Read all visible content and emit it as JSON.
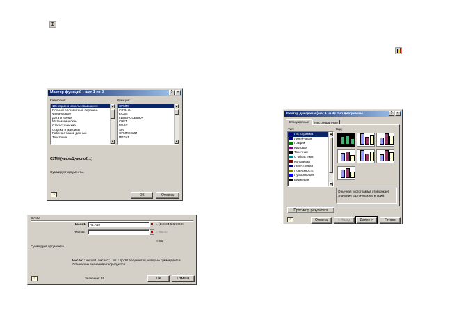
{
  "toolbar_icons": {
    "autosum": "sigma-icon",
    "chart_wizard": "chart-wizard-icon"
  },
  "function_wizard": {
    "title": "Мастер функций - шаг 1 из 2",
    "category_label": "Категория:",
    "function_label": "Функция:",
    "categories": [
      "10 недавно использовавшихся",
      "Полный алфавитный перечень",
      "Финансовые",
      "Дата и время",
      "Математические",
      "Статистические",
      "Ссылки и массивы",
      "Работа с базой данных",
      "Текстовые"
    ],
    "functions": [
      "СУММ",
      "СРЗНАЧ",
      "ЕСЛИ",
      "ГИПЕРССЫЛКА",
      "СЧЕТ",
      "МАКС",
      "SIN",
      "СУММЕСЛИ",
      "ППЛАТ"
    ],
    "signature": "СУММ(число1;число2;...)",
    "description": "Суммирует аргументы.",
    "ok": "ОК",
    "cancel": "Отмена"
  },
  "args_dialog": {
    "function_name": "СУММ",
    "number1_label": "Число1",
    "number1_value": "A1:A10",
    "number1_result": "= {1:2:3:4:5:6:7:8:9:",
    "number2_label": "Число2",
    "number2_result": "= число",
    "total": "= 55",
    "description": "Суммирует аргументы.",
    "arg_help_bold": "Число1:",
    "arg_help": "число1; число2;... от 1 до 30 аргументов, которые суммируются. Логические значения игнорируются.",
    "value_line": "Значение: 55",
    "ok": "ОК",
    "cancel": "Отмена"
  },
  "chart_wizard": {
    "title": "Мастер диаграмм (шаг 1 из 4): тип диаграммы",
    "tab_standard": "Стандартные",
    "tab_custom": "Нестандартные",
    "type_label": "Тип:",
    "view_label": "Вид:",
    "types": [
      "Гистограмма",
      "Линейчатая",
      "График",
      "Круговая",
      "Точечная",
      "С областями",
      "Кольцевая",
      "Лепестковая",
      "Поверхность",
      "Пузырьковая",
      "Биржевая"
    ],
    "type_icons": [
      "column-chart-icon",
      "bar-chart-icon",
      "line-chart-icon",
      "pie-chart-icon",
      "scatter-chart-icon",
      "area-chart-icon",
      "doughnut-chart-icon",
      "radar-chart-icon",
      "surface-chart-icon",
      "bubble-chart-icon",
      "stock-chart-icon"
    ],
    "type_icon_colors": [
      "#000080",
      "#000080",
      "#008000",
      "#800080",
      "#000000",
      "#008080",
      "#800000",
      "#000080",
      "#808000",
      "#0000ff",
      "#000000"
    ],
    "view_description": "Обычная гистограмма отображает значения различных категорий.",
    "preview_button": "Просмотр результата",
    "cancel": "Отмена",
    "back": "< Назад",
    "next": "Далее >",
    "finish": "Готово",
    "colors": {
      "series1": "#9999ff",
      "series2": "#993366",
      "series3": "#ffffcc"
    }
  }
}
